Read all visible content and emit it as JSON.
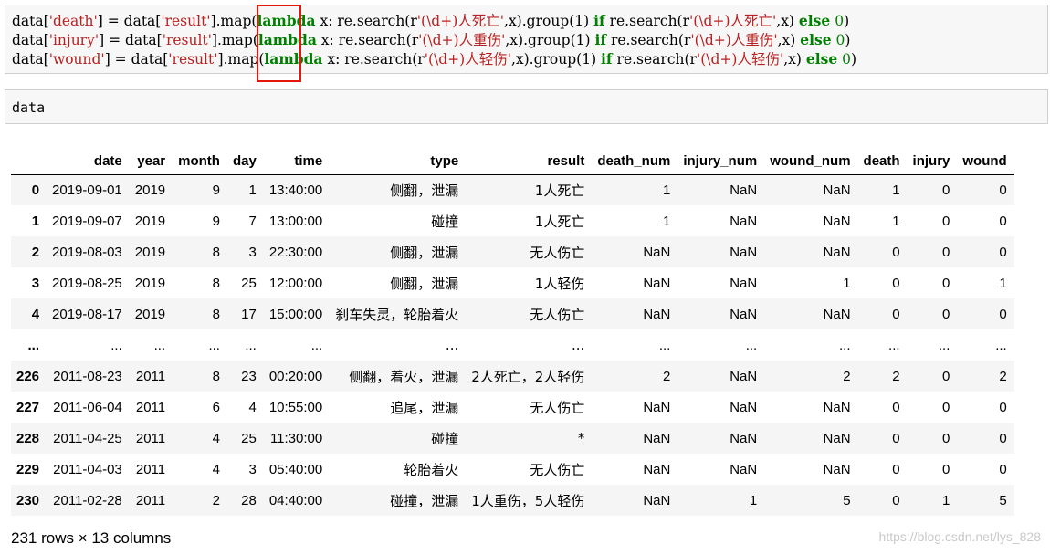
{
  "code_cell": {
    "lines": [
      {
        "pre": "data[",
        "col": "'death'",
        "mid": "] = data[",
        "src": "'result'",
        "call": "].map(",
        "kw1": "lambda",
        "body": " x: re.search(r",
        "pat": "'(\\d+)人死亡'",
        "after": ",x).group(1) ",
        "kw2": "if",
        "body2": " re.search(r",
        "pat2": "'(\\d+)人死亡'",
        "after2": ",x) ",
        "kw3": "else",
        "zero": " 0",
        "close": ")"
      },
      {
        "pre": "data[",
        "col": "'injury'",
        "mid": "] = data[",
        "src": "'result'",
        "call": "].map(",
        "kw1": "lambda",
        "body": " x: re.search(r",
        "pat": "'(\\d+)人重伤'",
        "after": ",x).group(1) ",
        "kw2": "if",
        "body2": " re.search(r",
        "pat2": "'(\\d+)人重伤'",
        "after2": ",x) ",
        "kw3": "else",
        "zero": " 0",
        "close": ")"
      },
      {
        "pre": "data[",
        "col": "'wound'",
        "mid": "] = data[",
        "src": "'result'",
        "call": "].map(",
        "kw1": "lambda",
        "body": " x: re.search(r",
        "pat": "'(\\d+)人轻伤'",
        "after": ",x).group(1) ",
        "kw2": "if",
        "body2": " re.search(r",
        "pat2": "'(\\d+)人轻伤'",
        "after2": ",x) ",
        "kw3": "else",
        "zero": " 0",
        "close": ")"
      }
    ]
  },
  "input_cell": {
    "text": "data"
  },
  "table": {
    "columns": [
      "",
      "date",
      "year",
      "month",
      "day",
      "time",
      "type",
      "result",
      "death_num",
      "injury_num",
      "wound_num",
      "death",
      "injury",
      "wound"
    ],
    "rows": [
      {
        "index": "0",
        "cells": [
          "2019-09-01",
          "2019",
          "9",
          "1",
          "13:40:00",
          "侧翻，泄漏",
          "1人死亡",
          "1",
          "NaN",
          "NaN",
          "1",
          "0",
          "0"
        ]
      },
      {
        "index": "1",
        "cells": [
          "2019-09-07",
          "2019",
          "9",
          "7",
          "13:00:00",
          "碰撞",
          "1人死亡",
          "1",
          "NaN",
          "NaN",
          "1",
          "0",
          "0"
        ]
      },
      {
        "index": "2",
        "cells": [
          "2019-08-03",
          "2019",
          "8",
          "3",
          "22:30:00",
          "侧翻，泄漏",
          "无人伤亡",
          "NaN",
          "NaN",
          "NaN",
          "0",
          "0",
          "0"
        ]
      },
      {
        "index": "3",
        "cells": [
          "2019-08-25",
          "2019",
          "8",
          "25",
          "12:00:00",
          "侧翻，泄漏",
          "1人轻伤",
          "NaN",
          "NaN",
          "1",
          "0",
          "0",
          "1"
        ]
      },
      {
        "index": "4",
        "cells": [
          "2019-08-17",
          "2019",
          "8",
          "17",
          "15:00:00",
          "刹车失灵，轮胎着火",
          "无人伤亡",
          "NaN",
          "NaN",
          "NaN",
          "0",
          "0",
          "0"
        ]
      },
      {
        "index": "...",
        "cells": [
          "...",
          "...",
          "...",
          "...",
          "...",
          "...",
          "...",
          "...",
          "...",
          "...",
          "...",
          "...",
          "..."
        ]
      },
      {
        "index": "226",
        "cells": [
          "2011-08-23",
          "2011",
          "8",
          "23",
          "00:20:00",
          "侧翻，着火，泄漏",
          "2人死亡，2人轻伤",
          "2",
          "NaN",
          "2",
          "2",
          "0",
          "2"
        ]
      },
      {
        "index": "227",
        "cells": [
          "2011-06-04",
          "2011",
          "6",
          "4",
          "10:55:00",
          "追尾，泄漏",
          "无人伤亡",
          "NaN",
          "NaN",
          "NaN",
          "0",
          "0",
          "0"
        ]
      },
      {
        "index": "228",
        "cells": [
          "2011-04-25",
          "2011",
          "4",
          "25",
          "11:30:00",
          "碰撞",
          "*",
          "NaN",
          "NaN",
          "NaN",
          "0",
          "0",
          "0"
        ]
      },
      {
        "index": "229",
        "cells": [
          "2011-04-03",
          "2011",
          "4",
          "3",
          "05:40:00",
          "轮胎着火",
          "无人伤亡",
          "NaN",
          "NaN",
          "NaN",
          "0",
          "0",
          "0"
        ]
      },
      {
        "index": "230",
        "cells": [
          "2011-02-28",
          "2011",
          "2",
          "28",
          "04:40:00",
          "碰撞，泄漏",
          "1人重伤，5人轻伤",
          "NaN",
          "1",
          "5",
          "0",
          "1",
          "5"
        ]
      }
    ]
  },
  "footer": {
    "shape": "231 rows × 13 columns"
  },
  "watermark": {
    "text": "https://blog.csdn.net/lys_828"
  },
  "colors": {
    "highlight_box": "#e3170a",
    "string": "#ba2121",
    "keyword": "#008000",
    "cell_bg": "#f7f7f7"
  }
}
